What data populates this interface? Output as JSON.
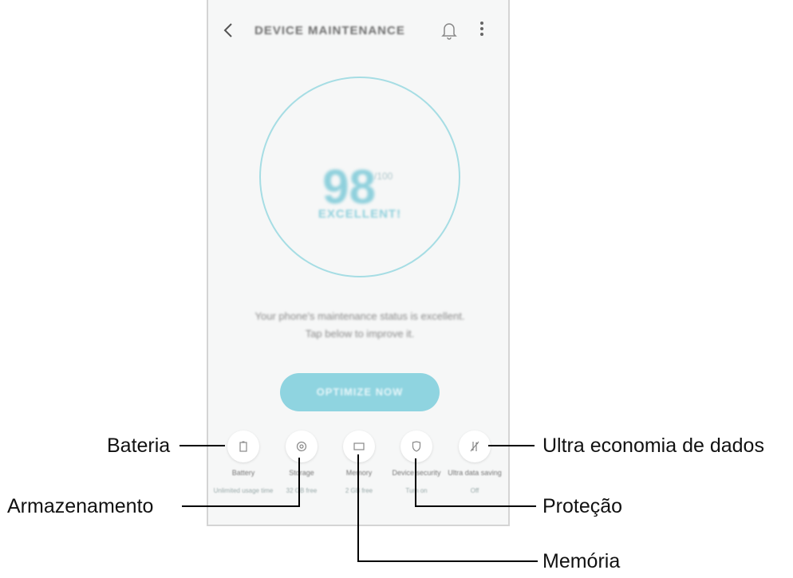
{
  "header": {
    "title": "DEVICE MAINTENANCE"
  },
  "icons": {
    "back": "chevron-left-icon",
    "bell": "bell-icon",
    "more": "more-vertical-icon"
  },
  "gauge": {
    "score": "98",
    "unit": "/100",
    "status": "EXCELLENT!",
    "ring_color": "#a6dde4"
  },
  "message": {
    "line1": "Your phone's maintenance status is excellent.",
    "line2": "Tap below to improve it."
  },
  "optimize_button": {
    "label": "OPTIMIZE NOW",
    "color": "#8fd4e0"
  },
  "tiles": [
    {
      "label": "Battery",
      "value": "Unlimited usage time",
      "icon": "battery-icon"
    },
    {
      "label": "Storage",
      "value": "32 GB free",
      "icon": "storage-icon"
    },
    {
      "label": "Memory",
      "value": "2 GB free",
      "icon": "memory-icon"
    },
    {
      "label": "Device security",
      "value": "Turn on",
      "icon": "shield-icon"
    },
    {
      "label": "Ultra data saving",
      "value": "Off",
      "icon": "data-saving-icon"
    }
  ],
  "callouts": {
    "battery": "Bateria",
    "storage": "Armazenamento",
    "memory": "Memória",
    "security": "Proteção",
    "data_saving": "Ultra economia de dados"
  }
}
